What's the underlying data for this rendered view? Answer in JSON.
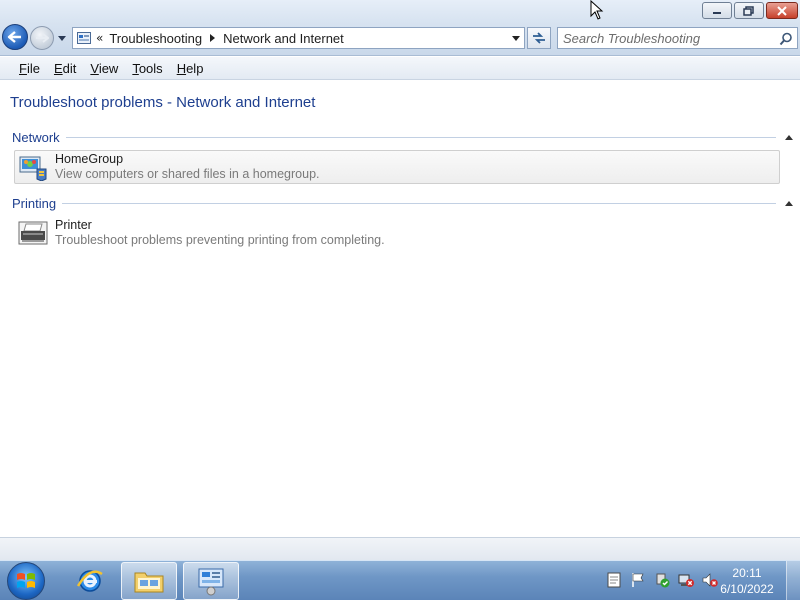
{
  "window": {
    "minimize_icon": "minimize-icon",
    "maximize_icon": "restore-icon",
    "close_icon": "close-icon"
  },
  "address": {
    "overflow": "«",
    "crumbs": [
      "Troubleshooting",
      "Network and Internet"
    ]
  },
  "search": {
    "placeholder": "Search Troubleshooting"
  },
  "menu": {
    "items": [
      {
        "label": "File",
        "accel": "F",
        "rest": "ile"
      },
      {
        "label": "Edit",
        "accel": "E",
        "rest": "dit"
      },
      {
        "label": "View",
        "accel": "V",
        "rest": "iew"
      },
      {
        "label": "Tools",
        "accel": "T",
        "rest": "ools"
      },
      {
        "label": "Help",
        "accel": "H",
        "rest": "elp"
      }
    ]
  },
  "page": {
    "title": "Troubleshoot problems - Network and Internet"
  },
  "sections": [
    {
      "label": "Network",
      "tasks": [
        {
          "name": "HomeGroup",
          "desc": "View computers or shared files in a homegroup.",
          "icon": "homegroup-icon"
        }
      ]
    },
    {
      "label": "Printing",
      "tasks": [
        {
          "name": "Printer",
          "desc": "Troubleshoot problems preventing printing from completing.",
          "icon": "printer-icon"
        }
      ]
    }
  ],
  "taskbar": {
    "clock_time": "20:11",
    "clock_date": "6/10/2022"
  },
  "colors": {
    "title_text": "#1e3f8f",
    "taskbar": "#6f97c6"
  }
}
